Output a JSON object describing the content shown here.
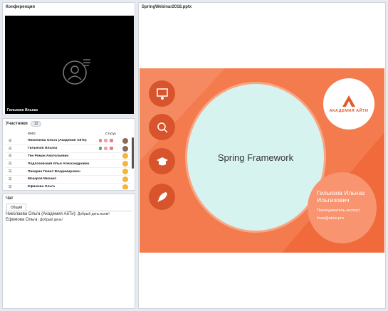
{
  "conference": {
    "title": "Конференция",
    "video_name": "Гильязов Ильназ"
  },
  "participants": {
    "title": "Участники",
    "count": "12",
    "columns": {
      "name": "ФИО",
      "status": "Статус"
    },
    "rows": [
      {
        "name": "Николаева Ольга (Академия АйТи)",
        "status": "moderator"
      },
      {
        "name": "Гильязов Ильназ",
        "status": "speaker"
      },
      {
        "name": "Тен Роман Анатольевич",
        "status": "listener"
      },
      {
        "name": "Подлозовский Илья Александрович",
        "status": "listener"
      },
      {
        "name": "Пикарин Павел Владимирович",
        "status": "listener"
      },
      {
        "name": "Макаров Михаил",
        "status": "listener"
      },
      {
        "name": "Ефимова Ольга",
        "status": "listener"
      }
    ]
  },
  "chat": {
    "title": "Чат",
    "tab": "Общий",
    "messages": [
      {
        "author": "Николаева Ольга (Академия АйТи):",
        "text": "Добрый день всем!"
      },
      {
        "author": "Ефимова Ольга:",
        "text": "Добрый день!"
      }
    ]
  },
  "presentation": {
    "title": "SpringWebinar2018.pptx",
    "slide": {
      "heading": "Spring Framework",
      "logo_text": "АКАДЕМИЯ АЙТИ",
      "speaker_name": "Гильязов Ильназ Ильгизович",
      "speaker_role": "Преподаватель-эксперт",
      "speaker_email": "ilnaz@aims.pro"
    }
  },
  "colors": {
    "slide_bg": "#f47b4e",
    "circle_fill": "#d6f3f0",
    "accent": "#e35a2c"
  }
}
